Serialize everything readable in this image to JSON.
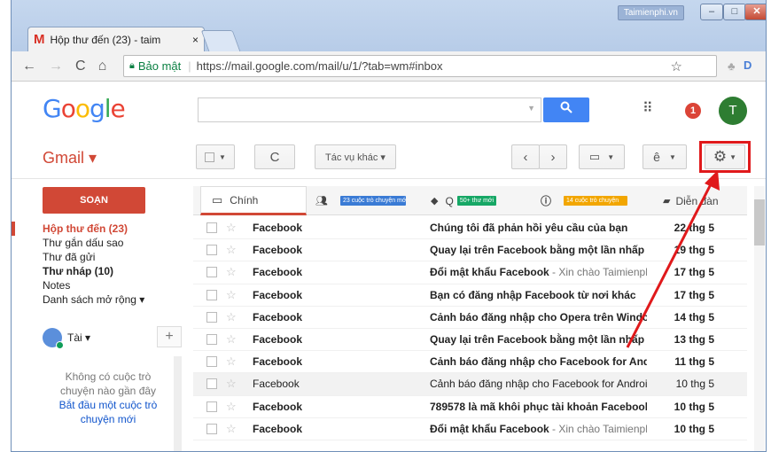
{
  "browser": {
    "tab_title": "Hộp thư đến (23) - taim",
    "tab_close": "×",
    "title_label": "Taimienphi.vn",
    "win_minimize": "–",
    "win_maximize": "□",
    "win_close": "✕",
    "secure_label": "Bảo mật",
    "url": "https://mail.google.com/mail/u/1/?tab=wm#inbox"
  },
  "header": {
    "logo": [
      "G",
      "o",
      "o",
      "g",
      "l",
      "e"
    ],
    "logo_colors": [
      "#4285f4",
      "#ea4335",
      "#fbbc05",
      "#4285f4",
      "#34a853",
      "#ea4335"
    ],
    "notification_count": "1",
    "avatar_letter": "T"
  },
  "toolbar": {
    "gmail_label": "Gmail ▾",
    "more_actions": "Tác vụ khác ▾",
    "input_tools": "ê"
  },
  "sidebar": {
    "compose": "SOẠN",
    "labels": [
      {
        "text": "Hộp thư đến (23)",
        "style": "active"
      },
      {
        "text": "Thư gắn dấu sao",
        "style": ""
      },
      {
        "text": "Thư đã gửi",
        "style": ""
      },
      {
        "text": "Thư nháp (10)",
        "style": "bold"
      },
      {
        "text": "Notes",
        "style": ""
      },
      {
        "text": "Danh sách mở rộng ▾",
        "style": ""
      }
    ],
    "chat_user": "Tài ▾",
    "chat_add": "+",
    "chat_empty_1": "Không có cuộc trò",
    "chat_empty_2": "chuyện nào gần đây",
    "chat_start_1": "Bắt đầu một cuộc trò",
    "chat_start_2": "chuyện mới"
  },
  "tabs": {
    "primary": "Chính",
    "social_badge": "23 cuộc trò chuyện mới",
    "promo_label": "Q",
    "promo_badge": "50+ thư mới",
    "updates_badge": "14 cuộc trò chuyện",
    "forums": "Diễn đàn"
  },
  "emails": [
    {
      "sender": "Facebook",
      "subject": "Chúng tôi đã phản hồi yêu cầu của bạn",
      "preview": "",
      "date": "22 thg 5",
      "read": false
    },
    {
      "sender": "Facebook",
      "subject": "Quay lại trên Facebook bằng một lần nhấp",
      "preview": "",
      "date": "19 thg 5",
      "read": false
    },
    {
      "sender": "Facebook",
      "subject": "Đổi mật khẩu Facebook",
      "preview": " - Xin chào Taimienphi",
      "date": "17 thg 5",
      "read": false
    },
    {
      "sender": "Facebook",
      "subject": "Bạn có đăng nhập Facebook từ nơi khác",
      "preview": "",
      "date": "17 thg 5",
      "read": false
    },
    {
      "sender": "Facebook",
      "subject": "Cảnh báo đăng nhập cho Opera trên Windows",
      "preview": "",
      "date": "14 thg 5",
      "read": false
    },
    {
      "sender": "Facebook",
      "subject": "Quay lại trên Facebook bằng một lần nhấp",
      "preview": "",
      "date": "13 thg 5",
      "read": false
    },
    {
      "sender": "Facebook",
      "subject": "Cảnh báo đăng nhập cho Facebook for Android",
      "preview": "",
      "date": "11 thg 5",
      "read": false
    },
    {
      "sender": "Facebook",
      "subject": "Cảnh báo đăng nhập cho Facebook for Android",
      "preview": "",
      "date": "10 thg 5",
      "read": true
    },
    {
      "sender": "Facebook",
      "subject": "789578 là mã khôi phục tài khoản Facebook",
      "preview": "",
      "date": "10 thg 5",
      "read": false
    },
    {
      "sender": "Facebook",
      "subject": "Đổi mật khẩu Facebook",
      "preview": " - Xin chào Taimienphi",
      "date": "10 thg 5",
      "read": false
    }
  ],
  "colors": {
    "accent": "#d14836",
    "search": "#4285f4",
    "highlight": "#e0191b",
    "social_badge": "#3a7bd5",
    "promo_badge": "#16a765",
    "updates_badge": "#f2a600"
  }
}
